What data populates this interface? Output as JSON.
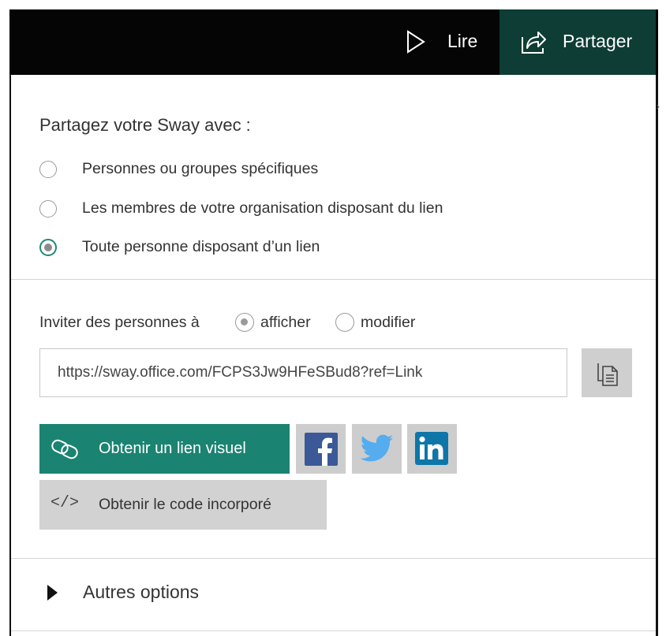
{
  "topbar": {
    "read_label": "Lire",
    "share_label": "Partager"
  },
  "share": {
    "heading": "Partagez votre Sway avec :",
    "options": [
      {
        "label": "Personnes ou groupes spécifiques",
        "selected": false
      },
      {
        "label": "Les membres de votre organisation disposant du lien",
        "selected": false
      },
      {
        "label": "Toute personne disposant d’un lien",
        "selected": true
      }
    ]
  },
  "invite": {
    "label": "Inviter des personnes à",
    "view_label": "afficher",
    "view_selected": true,
    "edit_label": "modifier",
    "edit_selected": false,
    "url": "https://sway.office.com/FCPS3Jw9HFeSBud8?ref=Link"
  },
  "actions": {
    "visual_link_label": "Obtenir un lien visuel",
    "embed_label": "Obtenir le code incorporé",
    "embed_icon_text": "</>",
    "social": [
      "facebook-icon",
      "twitter-icon",
      "linkedin-icon"
    ]
  },
  "more": {
    "label": "Autres options"
  },
  "colors": {
    "accent": "#1b8371",
    "header_share_bg": "#0d3d34",
    "header_bg": "#050505",
    "facebook": "#3b5998",
    "twitter": "#55acee",
    "linkedin": "#0e76a8"
  }
}
